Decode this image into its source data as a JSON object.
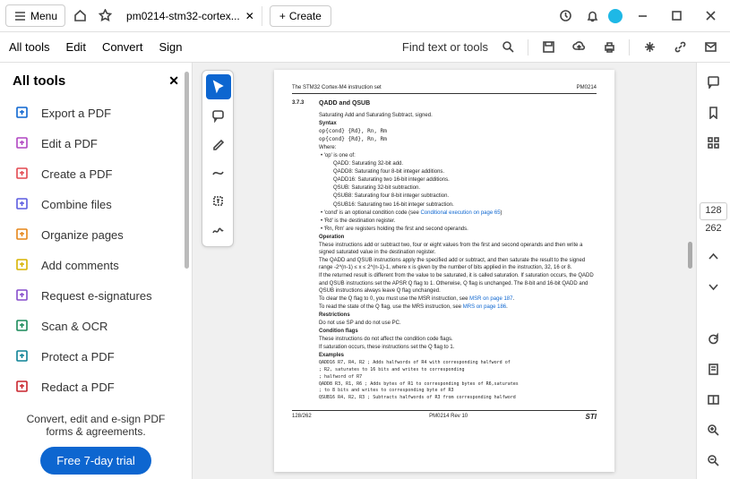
{
  "titlebar": {
    "menu": "Menu",
    "tab_title": "pm0214-stm32-cortex...",
    "create": "Create"
  },
  "toolbar": {
    "all_tools": "All tools",
    "edit": "Edit",
    "convert": "Convert",
    "sign": "Sign",
    "find": "Find text or tools"
  },
  "sidebar": {
    "title": "All tools",
    "items": [
      {
        "label": "Export a PDF",
        "color": "#0d66d0"
      },
      {
        "label": "Edit a PDF",
        "color": "#b146c2"
      },
      {
        "label": "Create a PDF",
        "color": "#e34850"
      },
      {
        "label": "Combine files",
        "color": "#5c5ce0"
      },
      {
        "label": "Organize pages",
        "color": "#e68619"
      },
      {
        "label": "Add comments",
        "color": "#d7b300"
      },
      {
        "label": "Request e-signatures",
        "color": "#864ccc"
      },
      {
        "label": "Scan & OCR",
        "color": "#1a8a5a"
      },
      {
        "label": "Protect a PDF",
        "color": "#0d8296"
      },
      {
        "label": "Redact a PDF",
        "color": "#c9252d"
      }
    ],
    "footer": "Convert, edit and e-sign PDF forms & agreements.",
    "trial": "Free 7-day trial"
  },
  "pages": {
    "current": "128",
    "total": "262"
  },
  "doc": {
    "hdr_left": "The STM32 Cortex-M4 instruction set",
    "hdr_right": "PM0214",
    "sec_no": "3.7.3",
    "sec_title": "QADD and QSUB",
    "subtitle": "Saturating Add and Saturating Subtract, signed.",
    "syntax_h": "Syntax",
    "syn1": "op{cond} {Rd}, Rn, Rm",
    "syn2": "op{cond} {Rd}, Rn, Rm",
    "where": "Where:",
    "b_op": "• 'op' is one of:",
    "op1": "QADD: Saturating 32-bit add.",
    "op2": "QADD8: Saturating four 8-bit integer additions.",
    "op3": "QADD16: Saturating two 16-bit integer additions.",
    "op4": "QSUB: Saturating 32-bit subtraction.",
    "op5": "QSUB8: Saturating four 8-bit integer subtraction.",
    "op6": "QSUB16: Saturating two 16-bit integer subtraction.",
    "b_cond": "• 'cond' is an optional condition code (see ",
    "cond_link": "Conditional execution on page 65",
    "b_rd": "• 'Rd' is the destination register.",
    "b_rnrm": "• 'Rn, Rm' are registers holding the first and second operands.",
    "op_h": "Operation",
    "op_p1": "These instructions add or subtract two, four or eight values from the first and second operands and then write a signed saturated value in the destination register.",
    "op_p2": "The QADD and QSUB instructions apply the specified add or subtract, and then saturate the result to the signed range -2^(n-1) ≤ x ≤ 2^(n-1)-1, where x is given by the number of bits applied in the instruction, 32, 16 or 8.",
    "op_p3": "If the returned result is different from the value to be saturated, it is called saturation. If saturation occurs, the QADD and QSUB instructions set the APSR Q flag to 1. Otherwise, Q flag is unchanged. The 8-bit and 16-bit QADD and QSUB instructions always leave Q flag unchanged.",
    "op_p4a": "To clear the Q flag to 0, you must use the MSR instruction, see ",
    "op_p4_link": "MSR on page 187",
    "op_p5a": "To read the state of the Q flag, use the MRS instruction, see ",
    "op_p5_link": "MRS on page 186",
    "res_h": "Restrictions",
    "res1": "Do not use SP and do not use PC.",
    "cf_h": "Condition flags",
    "cf1": "These instructions do not affect the condition code flags.",
    "cf2": "If saturation occurs, these instructions set the Q flag to 1.",
    "ex_h": "Examples",
    "ex1": "QADD16  R7, R4, R2  ; Adds halfwords of R4 with corresponding halfword of",
    "ex1b": "                    ; R2, saturates to 16 bits and writes to corresponding",
    "ex1c": "                    ; halfword of R7",
    "ex2": "QADD8   R3, R1, R6  ; Adds bytes of R1 to corresponding bytes of R6,saturates",
    "ex2b": "                    ; to 8 bits and writes to corresponding byte of R3",
    "ex3": "QSUB16  R4, R2, R3  ; Subtracts halfwords of R3 from corresponding halfword",
    "ftr_l": "128/262",
    "ftr_c": "PM0214 Rev 10",
    "ftr_logo": "STI"
  }
}
